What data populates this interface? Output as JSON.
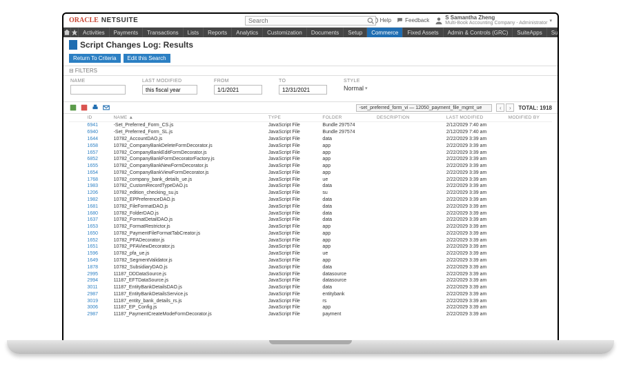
{
  "brand": {
    "oracle": "ORACLE",
    "netsuite": "NETSUITE"
  },
  "search": {
    "placeholder": "Search"
  },
  "utils": {
    "help": "Help",
    "feedback": "Feedback"
  },
  "user": {
    "name": "S Samantha Zheng",
    "role": "Multi-Book Accounting Company - Administrator"
  },
  "nav": {
    "items": [
      "Activities",
      "Payments",
      "Transactions",
      "Lists",
      "Reports",
      "Analytics",
      "Customization",
      "Documents",
      "Setup",
      "Commerce",
      "Fixed Assets",
      "Admin & Controls (GRC)",
      "SuiteApps",
      "Support"
    ],
    "activeIndex": 9
  },
  "page": {
    "title": "Script Changes Log: Results",
    "returnBtn": "Return To Criteria",
    "editBtn": "Edit this Search"
  },
  "filters": {
    "header": "FILTERS",
    "name": {
      "label": "NAME",
      "value": ""
    },
    "lastModified": {
      "label": "LAST MODIFIED",
      "value": "this fiscal year"
    },
    "from": {
      "label": "FROM",
      "value": "1/1/2021"
    },
    "to": {
      "label": "TO",
      "value": "12/31/2021"
    },
    "style": {
      "label": "STYLE",
      "value": "Normal"
    }
  },
  "list_toolbar": {
    "view": "-set_preferred_form_vi — 12050_payment_file_mgmt_ue",
    "total_label": "TOTAL:",
    "total": "1918"
  },
  "columns": [
    "",
    "ID",
    "NAME ▲",
    "TYPE",
    "FOLDER",
    "DESCRIPTION",
    "LAST MODIFIED",
    "MODIFIED BY"
  ],
  "rows": [
    {
      "id": "6941",
      "name": "-Set_Preferred_Form_CS.js",
      "type": "JavaScript File",
      "folder": "Bundle 297574",
      "desc": "",
      "mod": "2/12/2029 7:40 am",
      "by": ""
    },
    {
      "id": "6940",
      "name": "-Set_Preferred_Form_SL.js",
      "type": "JavaScript File",
      "folder": "Bundle 297574",
      "desc": "",
      "mod": "2/12/2029 7:40 am",
      "by": ""
    },
    {
      "id": "1644",
      "name": "10782_AccountDAO.js",
      "type": "JavaScript File",
      "folder": "data",
      "desc": "",
      "mod": "2/22/2029 3:39 am",
      "by": ""
    },
    {
      "id": "1658",
      "name": "10782_CompanyBankDeleteFormDecorator.js",
      "type": "JavaScript File",
      "folder": "app",
      "desc": "",
      "mod": "2/22/2029 3:39 am",
      "by": ""
    },
    {
      "id": "1657",
      "name": "10782_CompanyBankEditFormDecorator.js",
      "type": "JavaScript File",
      "folder": "app",
      "desc": "",
      "mod": "2/22/2029 3:39 am",
      "by": ""
    },
    {
      "id": "6852",
      "name": "10782_CompanyBankFormDecoratorFactory.js",
      "type": "JavaScript File",
      "folder": "app",
      "desc": "",
      "mod": "2/22/2029 3:39 am",
      "by": ""
    },
    {
      "id": "1655",
      "name": "10782_CompanyBankNewFormDecorator.js",
      "type": "JavaScript File",
      "folder": "app",
      "desc": "",
      "mod": "2/22/2029 3:39 am",
      "by": ""
    },
    {
      "id": "1654",
      "name": "10782_CompanyBankViewFormDecorator.js",
      "type": "JavaScript File",
      "folder": "app",
      "desc": "",
      "mod": "2/22/2029 3:39 am",
      "by": ""
    },
    {
      "id": "1768",
      "name": "10782_company_bank_details_ue.js",
      "type": "JavaScript File",
      "folder": "ue",
      "desc": "",
      "mod": "2/22/2029 3:39 am",
      "by": ""
    },
    {
      "id": "1983",
      "name": "10782_CustomRecordTypeDAO.js",
      "type": "JavaScript File",
      "folder": "data",
      "desc": "",
      "mod": "2/22/2029 3:39 am",
      "by": ""
    },
    {
      "id": "1206",
      "name": "10782_edition_checking_su.js",
      "type": "JavaScript File",
      "folder": "su",
      "desc": "",
      "mod": "2/22/2029 3:39 am",
      "by": ""
    },
    {
      "id": "1982",
      "name": "10782_EPPreferenceDAO.js",
      "type": "JavaScript File",
      "folder": "data",
      "desc": "",
      "mod": "2/22/2029 3:39 am",
      "by": ""
    },
    {
      "id": "1681",
      "name": "10782_FileFormatDAO.js",
      "type": "JavaScript File",
      "folder": "data",
      "desc": "",
      "mod": "2/22/2029 3:39 am",
      "by": ""
    },
    {
      "id": "1680",
      "name": "10782_FolderDAO.js",
      "type": "JavaScript File",
      "folder": "data",
      "desc": "",
      "mod": "2/22/2029 3:39 am",
      "by": ""
    },
    {
      "id": "1637",
      "name": "10782_FormatDetailDAO.js",
      "type": "JavaScript File",
      "folder": "data",
      "desc": "",
      "mod": "2/22/2029 3:39 am",
      "by": ""
    },
    {
      "id": "1653",
      "name": "10782_FormatRestrictor.js",
      "type": "JavaScript File",
      "folder": "app",
      "desc": "",
      "mod": "2/22/2029 3:39 am",
      "by": ""
    },
    {
      "id": "1650",
      "name": "10782_PaymentFileFormatTabCreator.js",
      "type": "JavaScript File",
      "folder": "app",
      "desc": "",
      "mod": "2/22/2029 3:39 am",
      "by": ""
    },
    {
      "id": "1652",
      "name": "10782_PFADecorator.js",
      "type": "JavaScript File",
      "folder": "app",
      "desc": "",
      "mod": "2/22/2029 3:39 am",
      "by": ""
    },
    {
      "id": "1651",
      "name": "10782_PFAViewDecorator.js",
      "type": "JavaScript File",
      "folder": "app",
      "desc": "",
      "mod": "2/22/2029 3:39 am",
      "by": ""
    },
    {
      "id": "1596",
      "name": "10782_pfa_ue.js",
      "type": "JavaScript File",
      "folder": "ue",
      "desc": "",
      "mod": "2/22/2029 3:39 am",
      "by": ""
    },
    {
      "id": "1649",
      "name": "10782_SegmentValidator.js",
      "type": "JavaScript File",
      "folder": "app",
      "desc": "",
      "mod": "2/22/2029 3:39 am",
      "by": ""
    },
    {
      "id": "1878",
      "name": "10782_SubsidiaryDAO.js",
      "type": "JavaScript File",
      "folder": "data",
      "desc": "",
      "mod": "2/22/2029 3:39 am",
      "by": ""
    },
    {
      "id": "2995",
      "name": "11187_DDDataSource.js",
      "type": "JavaScript File",
      "folder": "datasource",
      "desc": "",
      "mod": "2/22/2029 3:39 am",
      "by": ""
    },
    {
      "id": "2994",
      "name": "11187_EFTDataSource.js",
      "type": "JavaScript File",
      "folder": "datasource",
      "desc": "",
      "mod": "2/22/2029 3:39 am",
      "by": ""
    },
    {
      "id": "3011",
      "name": "11187_EntityBankDetailsDAO.js",
      "type": "JavaScript File",
      "folder": "data",
      "desc": "",
      "mod": "2/22/2029 3:39 am",
      "by": ""
    },
    {
      "id": "2987",
      "name": "11187_EntityBankDetailsService.js",
      "type": "JavaScript File",
      "folder": "entitybank",
      "desc": "",
      "mod": "2/22/2029 3:39 am",
      "by": ""
    },
    {
      "id": "3019",
      "name": "11187_entity_bank_details_rs.js",
      "type": "JavaScript File",
      "folder": "rs",
      "desc": "",
      "mod": "2/22/2029 3:39 am",
      "by": ""
    },
    {
      "id": "3006",
      "name": "11187_EP_Config.js",
      "type": "JavaScript File",
      "folder": "app",
      "desc": "",
      "mod": "2/22/2029 3:39 am",
      "by": ""
    },
    {
      "id": "2987",
      "name": "11187_PaymentCreateModeFormDecorator.js",
      "type": "JavaScript File",
      "folder": "payment",
      "desc": "",
      "mod": "2/22/2029 3:39 am",
      "by": ""
    }
  ]
}
